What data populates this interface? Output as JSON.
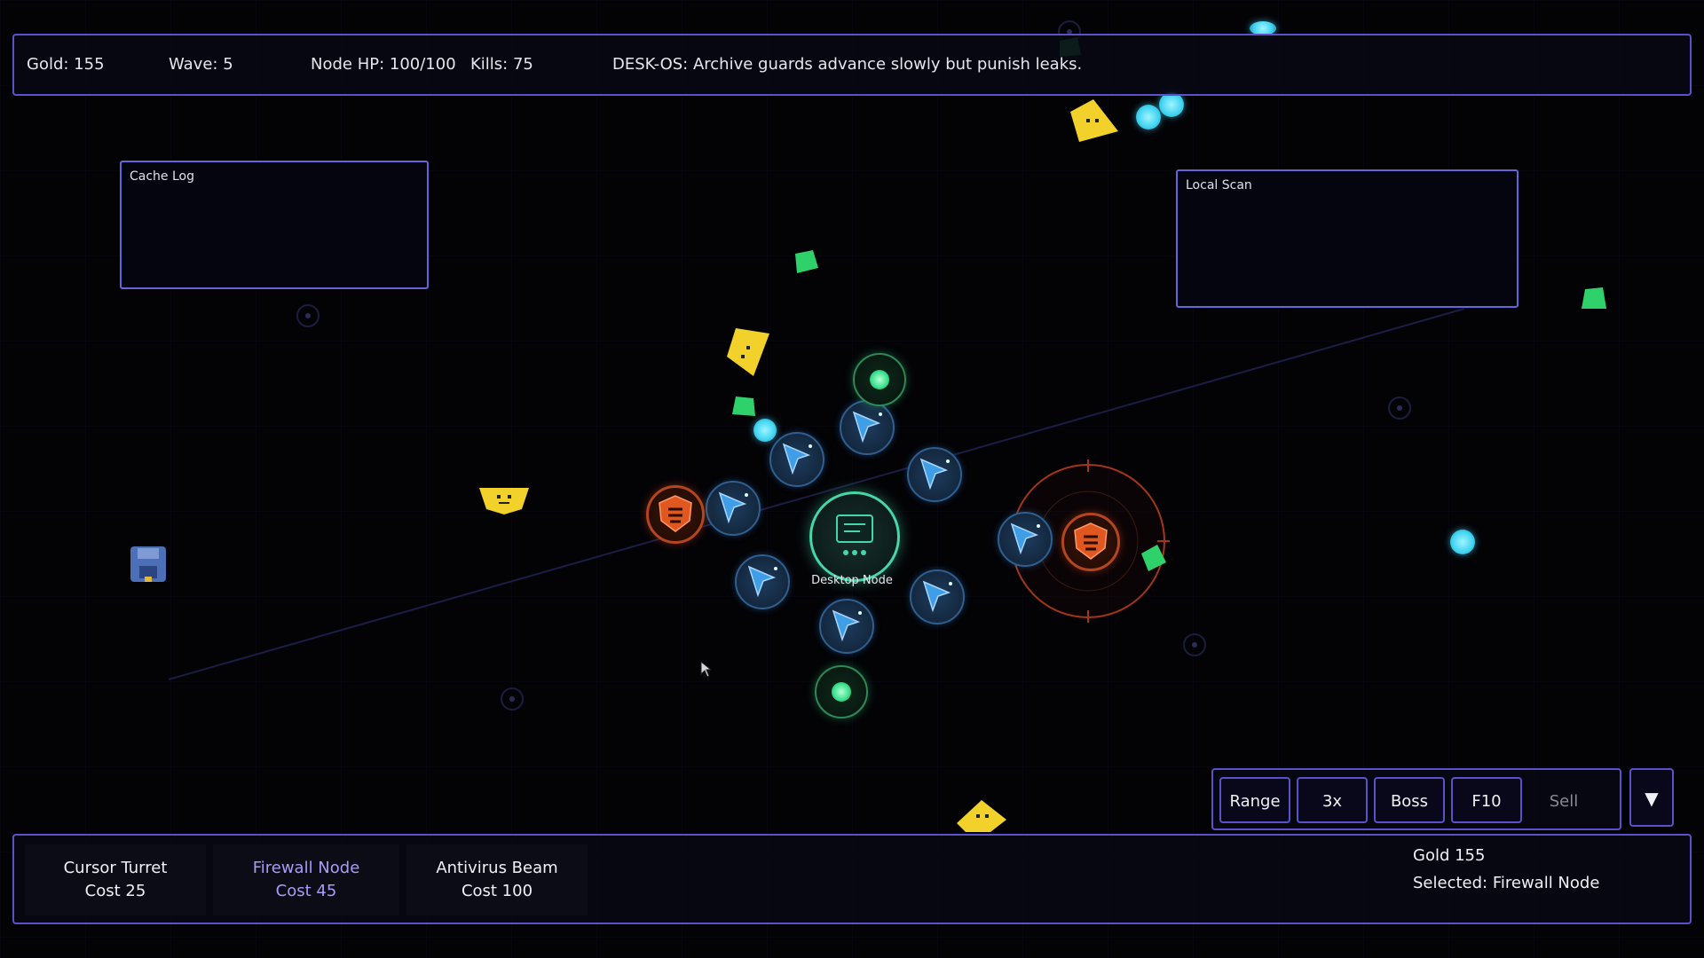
{
  "hud": {
    "gold": "Gold: 155",
    "wave": "Wave: 5",
    "node_hp": "Node HP: 100/100",
    "kills": "Kills: 75",
    "message": "DESK-OS: Archive guards advance slowly but punish leaks."
  },
  "panels": {
    "cache_log": "Cache Log",
    "local_scan": "Local Scan"
  },
  "core": {
    "label": "Desktop Node"
  },
  "controls": {
    "range": "Range",
    "speed": "3x",
    "boss": "Boss",
    "fullscreen": "F10",
    "sell": "Sell",
    "collapse": "▼"
  },
  "shop": {
    "items": [
      {
        "name": "Cursor Turret",
        "cost": "Cost 25"
      },
      {
        "name": "Firewall Node",
        "cost": "Cost 45"
      },
      {
        "name": "Antivirus Beam",
        "cost": "Cost 100"
      }
    ],
    "selected_index": 1
  },
  "status": {
    "gold": "Gold 155",
    "selected": "Selected: Firewall Node"
  },
  "colors": {
    "panel_border": "#5b52c9",
    "selected_text": "#a79cf6",
    "firewall": "#e0581f",
    "cursor_turret": "#3f9ee6",
    "beam": "#35e08a",
    "core": "#46d6a8",
    "enemy_yellow": "#f2d22a",
    "enemy_green": "#2fd16a",
    "enemy_cyan": "#3fd3f0"
  }
}
